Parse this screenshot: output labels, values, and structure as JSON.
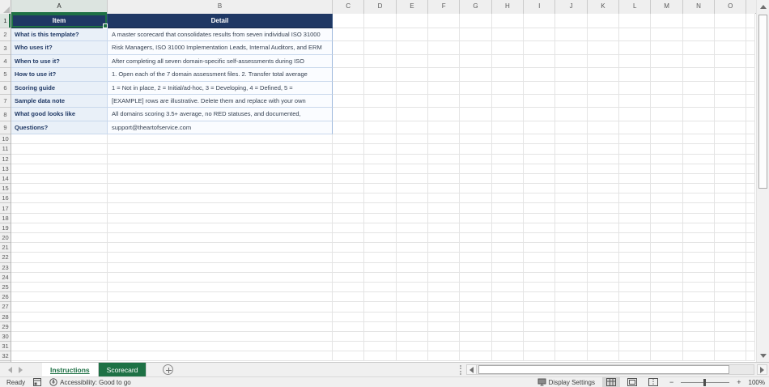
{
  "colors": {
    "header_navy": "#1F3864",
    "row_label_blue": "#E9F0F8",
    "detail_fill": "#FAFCFF",
    "table_border": "#C9D8EC",
    "excel_green": "#1E7145"
  },
  "sheet": {
    "columns": [
      "A",
      "B",
      "C",
      "D",
      "E",
      "F",
      "G",
      "H",
      "I",
      "J",
      "K",
      "L",
      "M",
      "N",
      "O"
    ],
    "row_numbers": [
      1,
      2,
      3,
      4,
      5,
      6,
      7,
      8,
      9,
      10,
      11,
      12,
      13,
      14,
      15,
      16,
      17,
      18,
      19,
      20,
      21,
      22,
      23,
      24,
      25,
      26,
      27,
      28,
      29,
      30,
      31,
      32
    ]
  },
  "table": {
    "headers": {
      "item": "Item",
      "detail": "Detail"
    },
    "rows": [
      {
        "item": "What is this template?",
        "detail": "A master scorecard that consolidates results from seven individual ISO 31000"
      },
      {
        "item": "Who uses it?",
        "detail": "Risk Managers, ISO 31000 Implementation Leads, Internal Auditors, and ERM"
      },
      {
        "item": "When to use it?",
        "detail": "After completing all seven domain-specific self-assessments during ISO"
      },
      {
        "item": "How to use it?",
        "detail": "1. Open each of the 7 domain assessment files. 2. Transfer total average"
      },
      {
        "item": "Scoring guide",
        "detail": "1 = Not in place, 2 = Initial/ad-hoc, 3 = Developing, 4 = Defined, 5 ="
      },
      {
        "item": "Sample data note",
        "detail": "[EXAMPLE] rows are illustrative. Delete them and replace with your own"
      },
      {
        "item": "What good looks like",
        "detail": "All domains scoring 3.5+ average, no RED statuses, and documented,"
      },
      {
        "item": "Questions?",
        "detail": "support@theartofservice.com"
      }
    ]
  },
  "tabs": {
    "items": [
      {
        "label": "Instructions",
        "active": true
      },
      {
        "label": "Scorecard",
        "active": false
      }
    ]
  },
  "status_bar": {
    "ready_label": "Ready",
    "accessibility_label": "Accessibility: Good to go",
    "display_settings_label": "Display Settings",
    "zoom_out_glyph": "−",
    "zoom_in_glyph": "+",
    "zoom_level": "100%"
  }
}
